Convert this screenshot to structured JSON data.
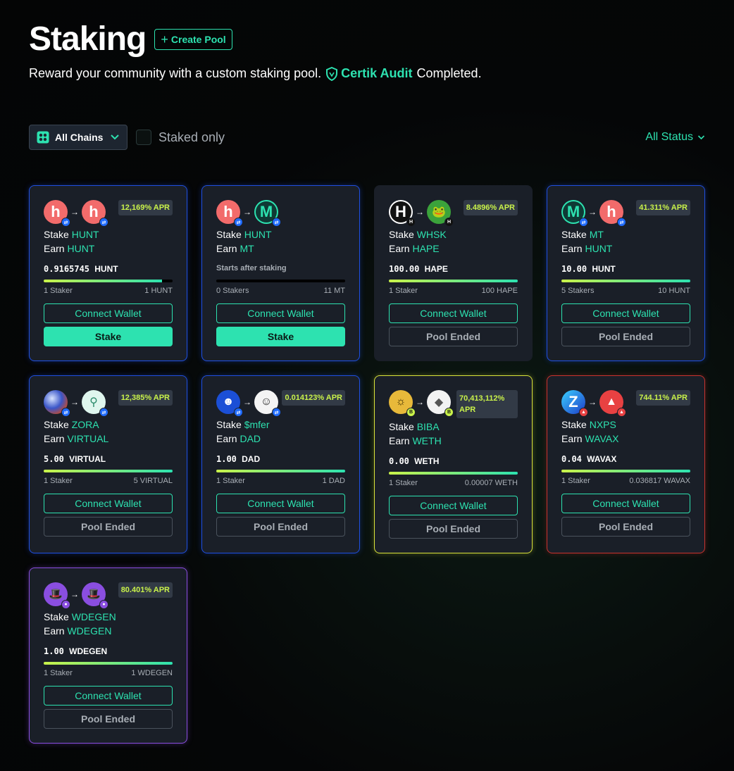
{
  "header": {
    "title": "Staking",
    "create_pool_label": "Create Pool",
    "subtitle_prefix": "Reward your community with a custom staking pool.",
    "certik_label": "Certik Audit",
    "subtitle_suffix": "Completed."
  },
  "toolbar": {
    "chain_select_value": "All Chains",
    "staked_only_label": "Staked only",
    "status_filter_label": "All Status"
  },
  "colors": {
    "accent": "#2de2b0",
    "apr": "#c9f24a"
  },
  "pools": [
    {
      "from": {
        "icon": "hunt-token-icon"
      },
      "to": {
        "icon": "hunt-token-icon"
      },
      "apr": "12,169% APR",
      "stake": "HUNT",
      "earn": "HUNT",
      "amount": "0.9165745",
      "unit": "HUNT",
      "progress": 0.92,
      "stakers": "1 Staker",
      "total": "1 HUNT",
      "connect": "Connect Wallet",
      "action": "Stake",
      "border": "blue"
    },
    {
      "from": {
        "icon": "hunt-token-icon"
      },
      "to": {
        "icon": "mt-token-icon"
      },
      "apr": "",
      "stake": "HUNT",
      "earn": "MT",
      "amount": "Starts after staking",
      "unit": "",
      "progress": 0,
      "stakers": "0 Stakers",
      "total": "11 MT",
      "connect": "Connect Wallet",
      "action": "Stake",
      "border": "blue"
    },
    {
      "from": {
        "icon": "whsk-token-icon"
      },
      "to": {
        "icon": "hape-token-icon"
      },
      "apr": "8.4896% APR",
      "stake": "WHSK",
      "earn": "HAPE",
      "amount": "100.00",
      "unit": "HAPE",
      "progress": 1,
      "stakers": "1 Staker",
      "total": "100 HAPE",
      "connect": "Connect Wallet",
      "action": "Pool Ended",
      "border": "none"
    },
    {
      "from": {
        "icon": "mt-token-icon"
      },
      "to": {
        "icon": "hunt-token-icon"
      },
      "apr": "41.311% APR",
      "stake": "MT",
      "earn": "HUNT",
      "amount": "10.00",
      "unit": "HUNT",
      "progress": 1,
      "stakers": "5 Stakers",
      "total": "10 HUNT",
      "connect": "Connect Wallet",
      "action": "Pool Ended",
      "border": "blue"
    },
    {
      "from": {
        "icon": "zora-token-icon"
      },
      "to": {
        "icon": "virtual-token-icon"
      },
      "apr": "12,385% APR",
      "stake": "ZORA",
      "earn": "VIRTUAL",
      "amount": "5.00",
      "unit": "VIRTUAL",
      "progress": 1,
      "stakers": "1 Staker",
      "total": "5 VIRTUAL",
      "connect": "Connect Wallet",
      "action": "Pool Ended",
      "border": "blue"
    },
    {
      "from": {
        "icon": "mfer-token-icon"
      },
      "to": {
        "icon": "dad-token-icon"
      },
      "apr": "0.014123% APR",
      "stake": "$mfer",
      "earn": "DAD",
      "amount": "1.00",
      "unit": "DAD",
      "progress": 1,
      "stakers": "1 Staker",
      "total": "1 DAD",
      "connect": "Connect Wallet",
      "action": "Pool Ended",
      "border": "blue"
    },
    {
      "from": {
        "icon": "biba-token-icon"
      },
      "to": {
        "icon": "weth-token-icon"
      },
      "apr": "70,413,112% APR",
      "stake": "BIBA",
      "earn": "WETH",
      "amount": "0.00",
      "unit": "WETH",
      "progress": 1,
      "stakers": "1 Staker",
      "total": "0.00007 WETH",
      "connect": "Connect Wallet",
      "action": "Pool Ended",
      "border": "yellow"
    },
    {
      "from": {
        "icon": "nxps-token-icon"
      },
      "to": {
        "icon": "wavax-token-icon"
      },
      "apr": "744.11% APR",
      "stake": "NXPS",
      "earn": "WAVAX",
      "amount": "0.04",
      "unit": "WAVAX",
      "progress": 1,
      "stakers": "1 Staker",
      "total": "0.036817 WAVAX",
      "connect": "Connect Wallet",
      "action": "Pool Ended",
      "border": "red"
    },
    {
      "from": {
        "icon": "wdegen-token-icon"
      },
      "to": {
        "icon": "wdegen-token-icon"
      },
      "apr": "80.401% APR",
      "stake": "WDEGEN",
      "earn": "WDEGEN",
      "amount": "1.00",
      "unit": "WDEGEN",
      "progress": 1,
      "stakers": "1 Staker",
      "total": "1 WDEGEN",
      "connect": "Connect Wallet",
      "action": "Pool Ended",
      "border": "purple"
    }
  ],
  "static": {
    "stake_word": "Stake",
    "earn_word": "Earn"
  }
}
